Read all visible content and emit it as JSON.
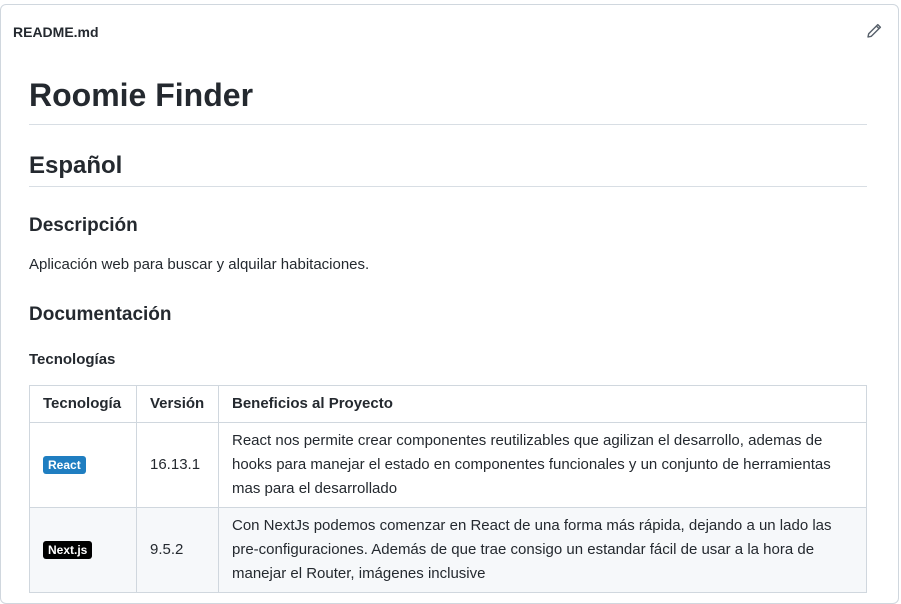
{
  "file": {
    "name": "README.md",
    "edit_icon": "pencil-icon"
  },
  "readme": {
    "title": "Roomie Finder",
    "section_lang": "Español",
    "desc_heading": "Descripción",
    "desc_text": "Aplicación web para buscar y alquilar habitaciones.",
    "doc_heading": "Documentación",
    "tech_heading": "Tecnologías",
    "table": {
      "headers": [
        "Tecnología",
        "Versión",
        "Beneficios al Proyecto"
      ],
      "rows": [
        {
          "badge": "React",
          "badge_color": "#1f7ec1",
          "version": "16.13.1",
          "benefit": "React nos permite crear componentes reutilizables que agilizan el desarrollo, ademas de hooks para manejar el estado en componentes funcionales y un conjunto de herramientas mas para el desarrollado"
        },
        {
          "badge": "Next.js",
          "badge_color": "#000000",
          "version": "9.5.2",
          "benefit": "Con NextJs podemos comenzar en React de una forma más rápida, dejando a un lado las pre-configuraciones. Además de que trae consigo un estandar fácil de usar a la hora de manejar el Router, imágenes inclusive"
        }
      ]
    }
  }
}
